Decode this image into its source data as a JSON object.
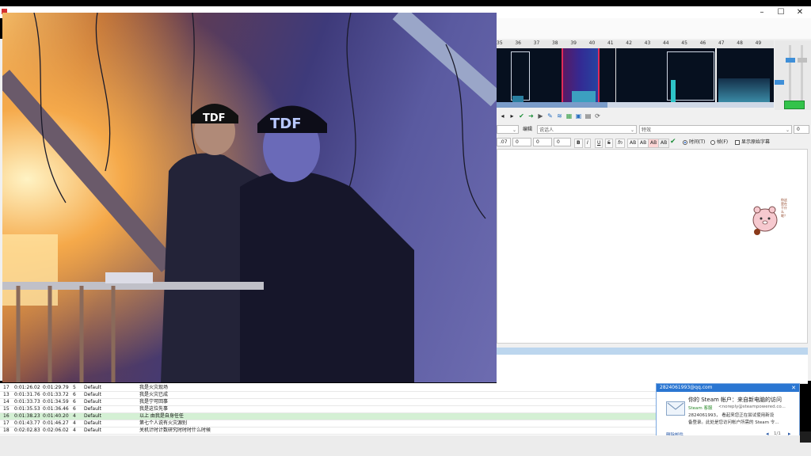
{
  "window": {
    "title": "",
    "minimize_glyph": "–",
    "maximize_glyph": "☐",
    "close_glyph": "✕"
  },
  "audio": {
    "timeline_labels": [
      "35",
      "36",
      "37",
      "38",
      "39",
      "40",
      "41",
      "42",
      "43",
      "44",
      "45",
      "46",
      "47",
      "48",
      "49"
    ]
  },
  "edit": {
    "actor_label": "编辑",
    "actor_value": "说话人",
    "effect_value": "特效",
    "layer_value": "0",
    "time_value": ".07",
    "margin_l": "0",
    "margin_r": "0",
    "margin_v": "0",
    "bold": "B",
    "italic": "I",
    "underline": "U",
    "strike": "S",
    "fn": "fn",
    "color1": "AB",
    "color2": "AB",
    "color3": "AB",
    "color4": "AB",
    "commit": "✔",
    "radio_time_label": "时间(T)",
    "radio_frame_label": "帧(F)",
    "show_original_label": "显示原始字幕"
  },
  "video": {
    "cap_text_1": "TDF",
    "cap_text_2": "TDF"
  },
  "grid_rows": [
    {
      "num": "17",
      "start": "0:01:26.02",
      "end": "0:01:29.79",
      "cps": "5",
      "style": "Default",
      "text": "我是火灾现场"
    },
    {
      "num": "13",
      "start": "0:01:31.76",
      "end": "0:01:33.72",
      "cps": "6",
      "style": "Default",
      "text": "我是火灾已成"
    },
    {
      "num": "14",
      "start": "0:01:33.73",
      "end": "0:01:34.59",
      "cps": "6",
      "style": "Default",
      "text": "我是宁可回事"
    },
    {
      "num": "15",
      "start": "0:01:35.53",
      "end": "0:01:36.46",
      "cps": "6",
      "style": "Default",
      "text": "我是这位先事"
    },
    {
      "num": "16",
      "start": "0:01:38.23",
      "end": "0:01:40.20",
      "cps": "4",
      "style": "Default",
      "text": "以上 由我是自身任任",
      "highlight": true
    },
    {
      "num": "17",
      "start": "0:01:43.77",
      "end": "0:01:46.27",
      "cps": "4",
      "style": "Default",
      "text": "第七个人说有火灾源别"
    },
    {
      "num": "18",
      "start": "0:02:02.83",
      "end": "0:02:06.02",
      "cps": "4",
      "style": "Default",
      "text": "关机计时计数研究时时时什么时候"
    }
  ],
  "notification": {
    "account": "2824061993@qq.com",
    "title": "你的 Steam 帐户：来自新电脑的访问",
    "sender_name": "Steam 客服",
    "sender_email": "<noreply@steampowered.co...",
    "body_line1": "2824061993，     看起来您正在尝试使用新设",
    "body_line2": "备登录。此处是您访问帐户所需的 Steam 令...",
    "delete_label": "删除邮件",
    "page": "1/1",
    "close_glyph": "✕"
  },
  "sticker": {
    "side_text": "你这是在干什么呢？"
  },
  "colors": {
    "accent": "#2a76d2",
    "row_highlight": "#d4f0d4",
    "spectrum_bg": "#06101f"
  }
}
